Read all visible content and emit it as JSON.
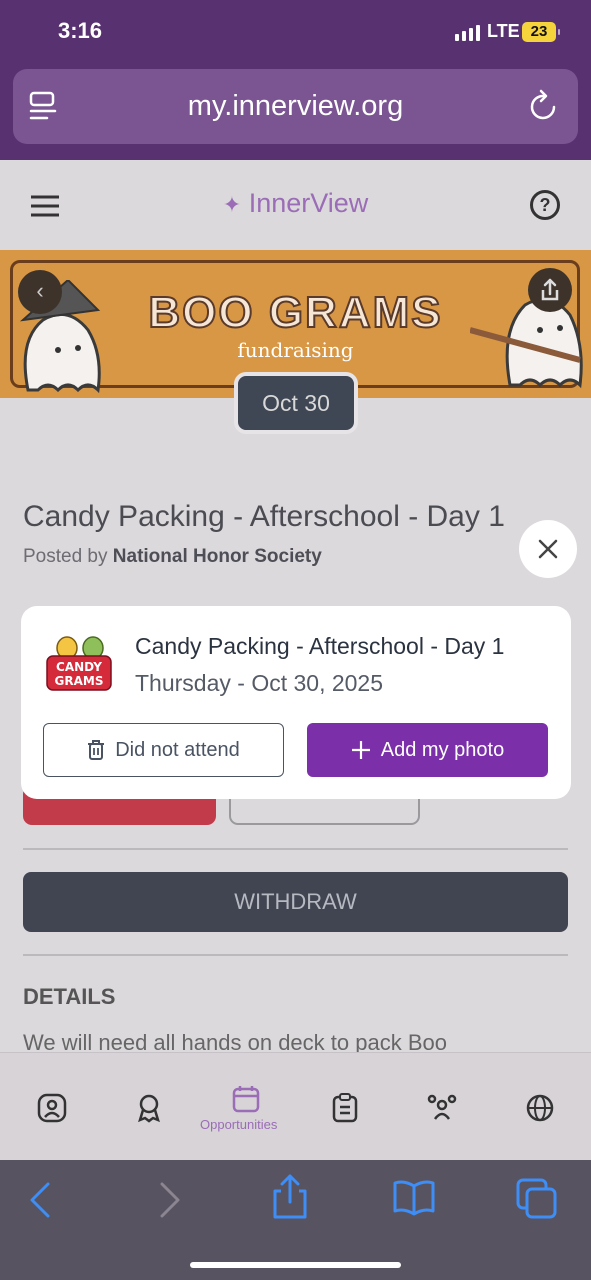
{
  "status_bar": {
    "time": "3:16",
    "network": "LTE",
    "battery": "23"
  },
  "browser": {
    "url": "my.innerview.org"
  },
  "header": {
    "logo_text": "InnerView"
  },
  "banner": {
    "title": "BOO GRAMS",
    "subtitle": "fundraising",
    "date_pill": "Oct 30"
  },
  "event": {
    "title": "Candy Packing - Afterschool - Day 1",
    "posted_prefix": "Posted by ",
    "posted_by": "National Honor Society"
  },
  "actions": {
    "withdraw": "WITHDRAW"
  },
  "details": {
    "heading": "DETAILS",
    "description": "We will need all hands on deck to pack Boo"
  },
  "bottom_nav": {
    "active_label": "Opportunities"
  },
  "modal": {
    "logo_text_line1": "CANDY",
    "logo_text_line2": "GRAMS",
    "title": "Candy Packing - Afterschool - Day 1",
    "date": "Thursday - Oct 30, 2025",
    "did_not_attend": "Did not attend",
    "add_photo": "Add my photo"
  },
  "colors": {
    "accent": "#7b2fa8",
    "header": "#583270",
    "volunteering_tag": "#c23b4b"
  }
}
